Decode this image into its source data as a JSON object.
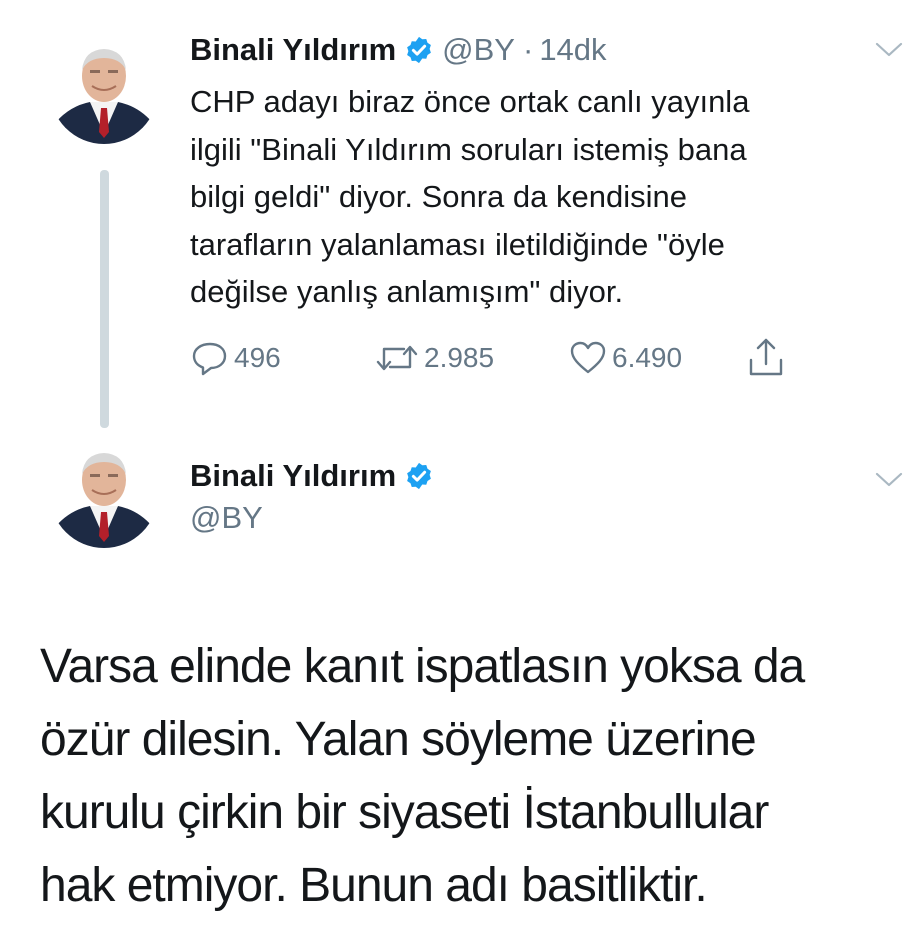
{
  "tweet1": {
    "author_name": "Binali Yıldırım",
    "handle": "@BY",
    "separator": "·",
    "time": "14dk",
    "text_lines": [
      "CHP adayı biraz önce ortak canlı yayınla",
      "ilgili \"Binali Yıldırım soruları istemiş bana",
      "bilgi geldi\" diyor. Sonra da kendisine",
      "tarafların yalanlaması iletildiğinde \"öyle",
      "değilse yanlış anlamışım\" diyor."
    ],
    "actions": {
      "reply_count": "496",
      "retweet_count": "2.985",
      "like_count": "6.490"
    }
  },
  "tweet2": {
    "author_name": "Binali Yıldırım",
    "handle": "@BY",
    "text_lines": [
      "Varsa elinde kanıt ispatlasın yoksa da",
      "özür dilesin. Yalan söyleme üzerine",
      "kurulu çirkin bir siyaseti İstanbullular",
      "hak etmiyor. Bunun adı basitliktir."
    ]
  },
  "icons": {
    "verified": "verified-badge-icon",
    "menu": "chevron-down-icon",
    "reply": "reply-icon",
    "retweet": "retweet-icon",
    "like": "heart-icon",
    "share": "share-icon"
  },
  "colors": {
    "text": "#14171a",
    "secondary": "#657786",
    "verified": "#1da1f2",
    "thread_line": "#cfd9de"
  }
}
